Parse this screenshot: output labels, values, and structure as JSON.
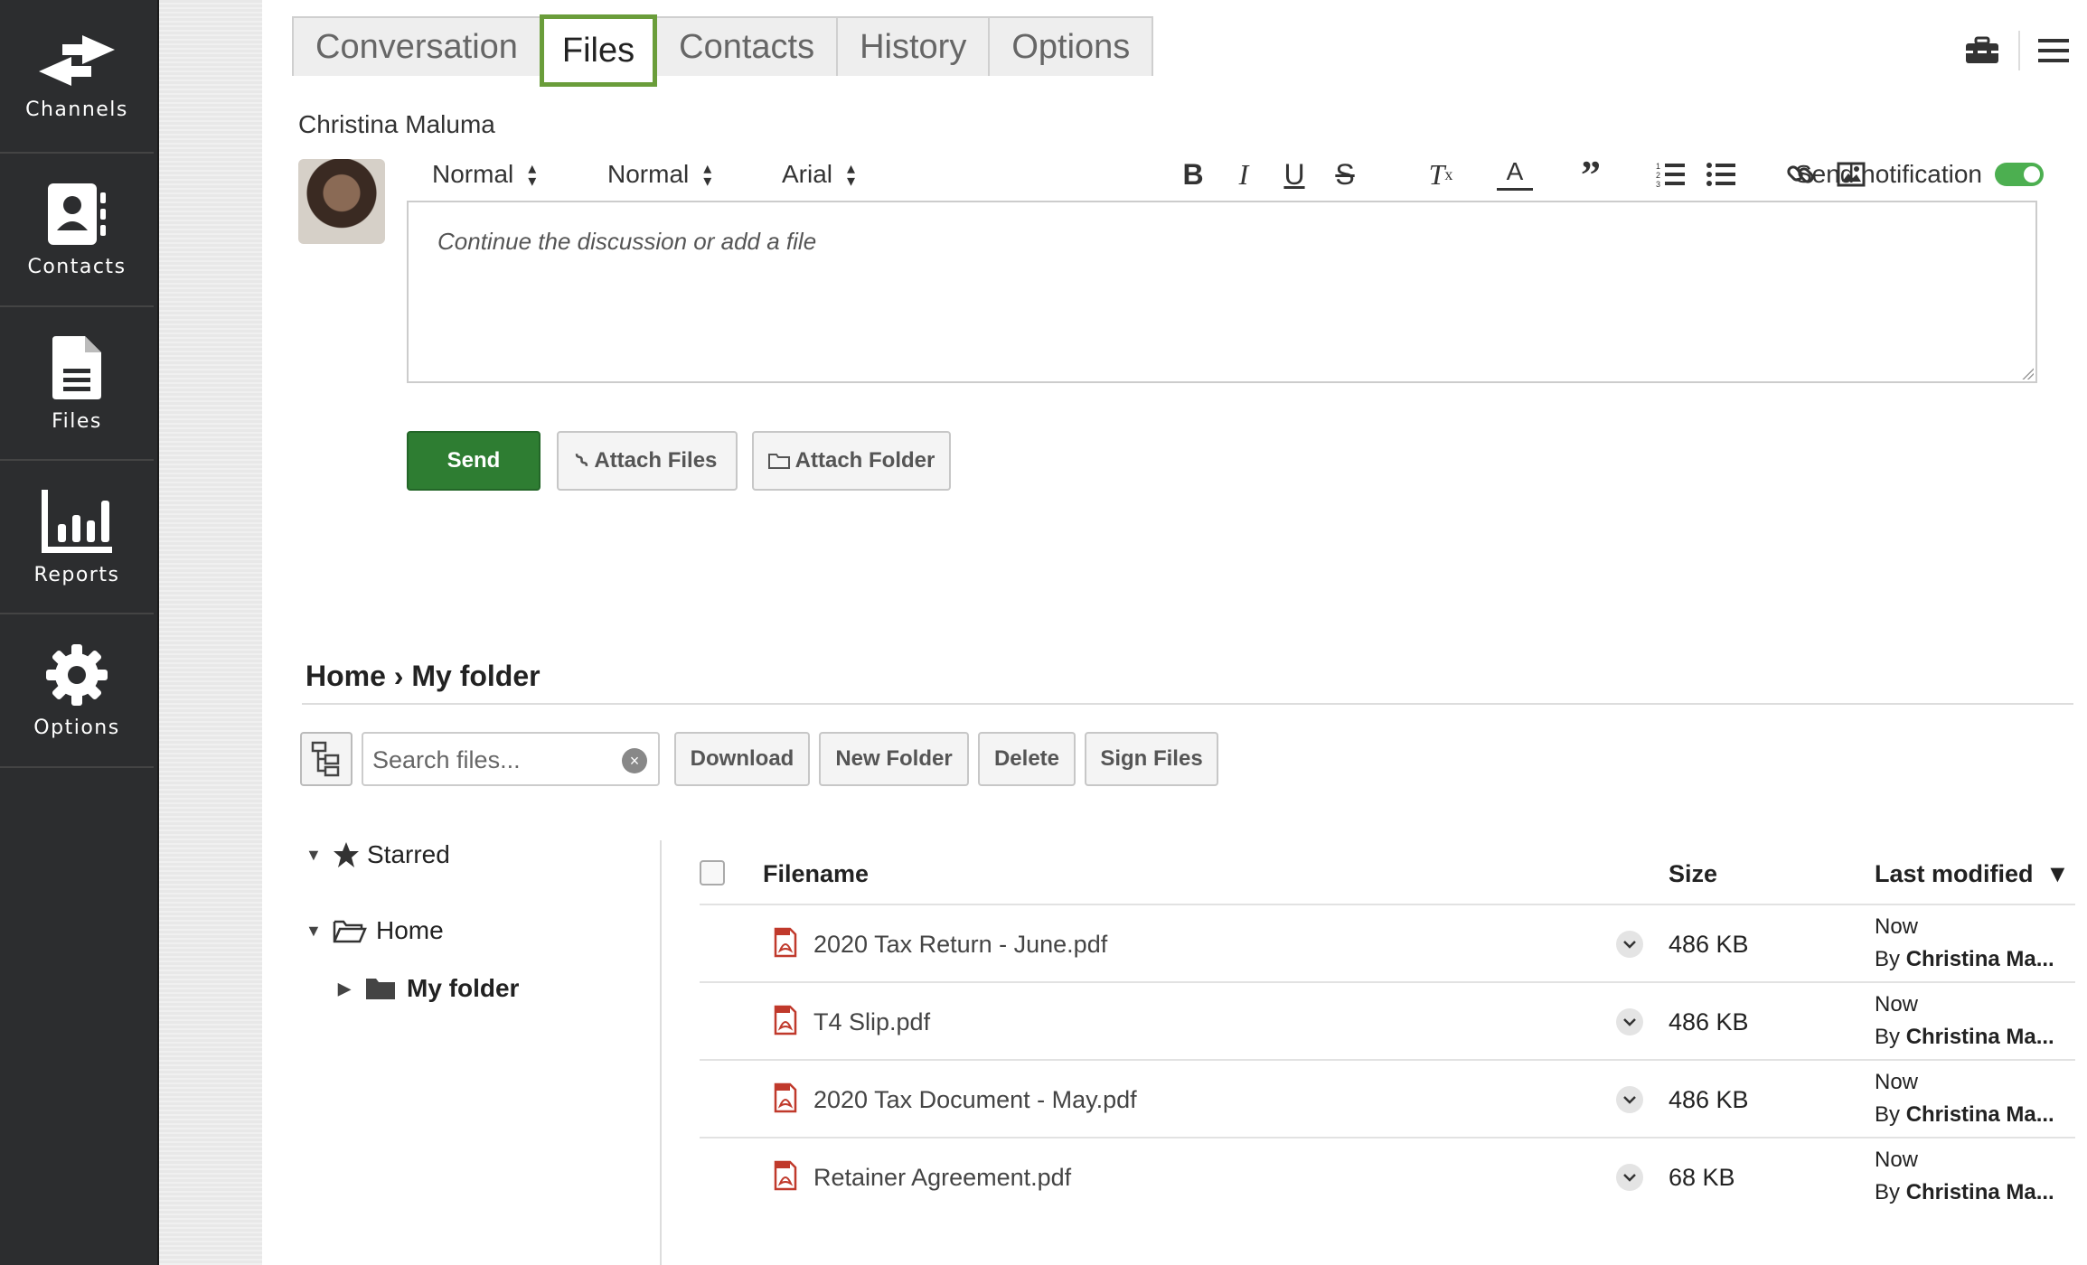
{
  "sidebar": {
    "items": [
      {
        "label": "Channels",
        "icon": "arrows-icon"
      },
      {
        "label": "Contacts",
        "icon": "contact-card-icon"
      },
      {
        "label": "Files",
        "icon": "document-icon"
      },
      {
        "label": "Reports",
        "icon": "bar-chart-icon"
      },
      {
        "label": "Options",
        "icon": "gear-icon"
      }
    ]
  },
  "tabs": [
    {
      "label": "Conversation",
      "active": false
    },
    {
      "label": "Files",
      "active": true
    },
    {
      "label": "Contacts",
      "active": false
    },
    {
      "label": "History",
      "active": false
    },
    {
      "label": "Options",
      "active": false
    }
  ],
  "composer": {
    "author": "Christina Maluma",
    "header_select": "Normal",
    "size_select": "Normal",
    "font_select": "Arial",
    "send_notification_label": "Send notification",
    "send_notification_on": true,
    "placeholder": "Continue the discussion or add a file",
    "send_label": "Send",
    "attach_files_label": "Attach Files",
    "attach_folder_label": "Attach Folder"
  },
  "breadcrumb": {
    "home": "Home",
    "separator": "›",
    "current": "My folder"
  },
  "file_toolbar": {
    "search_placeholder": "Search files...",
    "download_label": "Download",
    "new_folder_label": "New Folder",
    "delete_label": "Delete",
    "sign_files_label": "Sign Files"
  },
  "tree": {
    "starred": "Starred",
    "home": "Home",
    "my_folder": "My folder"
  },
  "table": {
    "headers": {
      "filename": "Filename",
      "size": "Size",
      "last_modified": "Last modified"
    },
    "sort_indicator": "▼",
    "rows": [
      {
        "filename": "2020 Tax Return - June.pdf",
        "size": "486 KB",
        "modified": "Now",
        "by_prefix": "By",
        "by": "Christina Ma..."
      },
      {
        "filename": "T4 Slip.pdf",
        "size": "486 KB",
        "modified": "Now",
        "by_prefix": "By",
        "by": "Christina Ma..."
      },
      {
        "filename": "2020 Tax Document - May.pdf",
        "size": "486 KB",
        "modified": "Now",
        "by_prefix": "By",
        "by": "Christina Ma..."
      },
      {
        "filename": "Retainer Agreement.pdf",
        "size": "68 KB",
        "modified": "Now",
        "by_prefix": "By",
        "by": "Christina Ma..."
      }
    ]
  },
  "colors": {
    "sidebar_bg": "#2c2d2f",
    "accent_green": "#2e7d32",
    "active_tab_border": "#6a9d3a",
    "toggle_on": "#4caf50",
    "pdf_red": "#c0392b"
  }
}
